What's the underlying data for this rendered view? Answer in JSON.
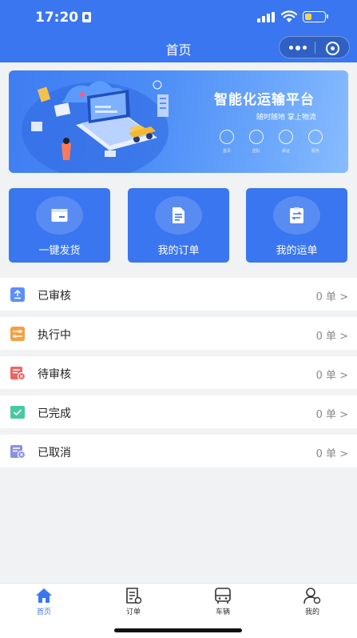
{
  "status_bar": {
    "time": "17:20"
  },
  "navbar": {
    "title": "首页"
  },
  "banner": {
    "title": "智能化运输平台",
    "subtitle": "随时随地 掌上物流",
    "features": [
      "首页",
      "团队",
      "承运",
      "服务"
    ]
  },
  "quick_actions": [
    {
      "label": "一键发货",
      "icon": "box-icon"
    },
    {
      "label": "我的订单",
      "icon": "document-icon"
    },
    {
      "label": "我的运单",
      "icon": "transfer-icon"
    }
  ],
  "order_status": [
    {
      "label": "已审核",
      "count": "0 单 >",
      "icon": "approved-icon",
      "color": "#5b8ff9"
    },
    {
      "label": "执行中",
      "count": "0 单 >",
      "icon": "in-progress-icon",
      "color": "#f5a044"
    },
    {
      "label": "待审核",
      "count": "0 单 >",
      "icon": "pending-review-icon",
      "color": "#ef6565"
    },
    {
      "label": "已完成",
      "count": "0 单 >",
      "icon": "completed-icon",
      "color": "#47c9a2"
    },
    {
      "label": "已取消",
      "count": "0 单 >",
      "icon": "cancelled-icon",
      "color": "#8b8fe6"
    }
  ],
  "tabbar": [
    {
      "label": "首页",
      "icon": "home-icon",
      "active": true
    },
    {
      "label": "订单",
      "icon": "order-icon",
      "active": false
    },
    {
      "label": "车辆",
      "icon": "vehicle-icon",
      "active": false
    },
    {
      "label": "我的",
      "icon": "profile-icon",
      "active": false
    }
  ],
  "colors": {
    "primary": "#3a76f0",
    "background": "#f1f2f4"
  }
}
